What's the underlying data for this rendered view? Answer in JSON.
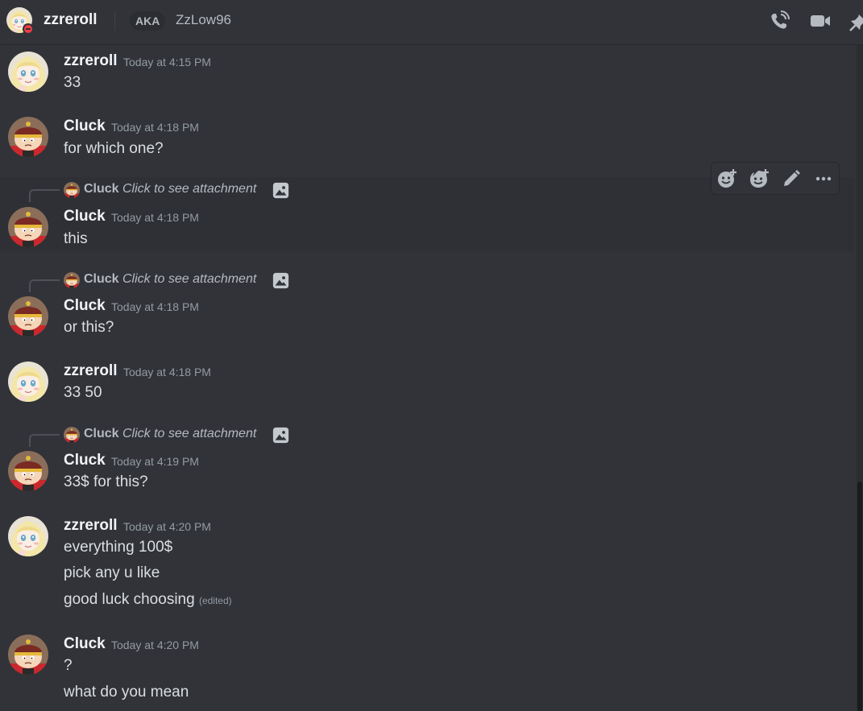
{
  "header": {
    "name": "zzreroll",
    "aka_label": "AKA",
    "alias": "ZzLow96",
    "icons": [
      "call-icon",
      "video-call-icon",
      "pin-icon"
    ]
  },
  "reply_text": "Click to see attachment",
  "toolbar_icons": [
    "add-reaction-icon",
    "super-reaction-icon",
    "edit-icon",
    "more-options-icon"
  ],
  "messages": [
    {
      "author": "zzreroll",
      "time": "Today at 4:15 PM",
      "lines": [
        "33"
      ]
    },
    {
      "author": "Cluck",
      "time": "Today at 4:18 PM",
      "lines": [
        "for which one?"
      ]
    },
    {
      "author": "Cluck",
      "reply_to": "Cluck",
      "time": "Today at 4:18 PM",
      "lines": [
        "this"
      ]
    },
    {
      "author": "Cluck",
      "reply_to": "Cluck",
      "time": "Today at 4:18 PM",
      "lines": [
        "or this?"
      ]
    },
    {
      "author": "zzreroll",
      "time": "Today at 4:18 PM",
      "lines": [
        "33 50"
      ]
    },
    {
      "author": "Cluck",
      "reply_to": "Cluck",
      "time": "Today at 4:19 PM",
      "lines": [
        "33$ for this?"
      ]
    },
    {
      "author": "zzreroll",
      "time": "Today at 4:20 PM",
      "lines": [
        "everything 100$",
        "pick any u like",
        "good luck choosing"
      ],
      "edited_label": "(edited)"
    },
    {
      "author": "Cluck",
      "time": "Today at 4:20 PM",
      "lines": [
        "?",
        "what do you mean"
      ]
    }
  ],
  "colors": {
    "background": "#313338",
    "hover_background": "#2e3035",
    "username": "#f2f3f5",
    "timestamp": "#949ba4",
    "dnd_status": "#f23f43"
  }
}
